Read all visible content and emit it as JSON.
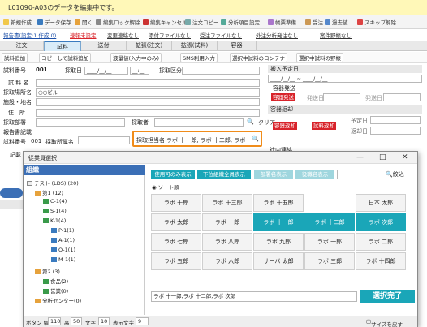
{
  "notice": "L01090-A03のデータを編集中です。",
  "toolbar": [
    "新規作成",
    "データ保存",
    "開く",
    "編集ロック解除",
    "編集キャンセル",
    "注文コピー",
    "分析項目設定",
    "帳票準備",
    "受注",
    "過去値",
    "スキップ解除"
  ],
  "links": [
    "報告書(設定:1 作成:0)",
    "速報未設定",
    "変更連絡なし",
    "添付ファイルなし",
    "受注ファイルなし",
    "外注分析発注なし",
    "案件野帳なし"
  ],
  "tabs": [
    "注文",
    "試料",
    "送付",
    "拡張(注文)",
    "拡張(試料)",
    "容器"
  ],
  "actions": [
    "試料追加",
    "コピーして試料追加",
    "液量値(入力中のみ)",
    "SMS利用入力",
    "選択中試料のコンテナ",
    "選択中試料の野帳"
  ],
  "form": {
    "no_label": "試料番号",
    "no_value": "001",
    "date_label": "採取日",
    "date_value": "____/__/__",
    "time_value": "__:__",
    "class_label": "採取区分",
    "name_label": "試 料 名",
    "place_label": "採取場所名",
    "place_value": "○○ビル",
    "facility_label": "施設・地名",
    "addr_label": "住　所",
    "dept_label": "採取部署",
    "staff_label": "採取者",
    "clear": "クリア",
    "report_label": "報告書記載",
    "sample_no_label": "試料番号",
    "sample_no_value": "001",
    "sample_place_label": "採取所属名",
    "person_label": "採取担当名",
    "person_value": "ラボ 十一郎, ラボ 十二郎, ラボ",
    "record_label": "記載"
  },
  "right": {
    "analysis_label": "搬入予定日",
    "analysis_value": "____/__/__ ~ ____/__/__",
    "container_label": "容器発送",
    "red1": "容器発送",
    "send_label": "発送日",
    "send_label2": "発送日",
    "return_label": "容器返却",
    "red2": "容器返却",
    "red3": "試料返却",
    "plan_label": "予定日",
    "ret_label": "返却日",
    "contact_label": "社内連絡"
  },
  "dialog": {
    "title": "従業員選択",
    "org": "組織",
    "filters": [
      "使用可のみ表示",
      "下位組織全員表示",
      "部署名表示",
      "役職名表示"
    ],
    "search_btn": "絞込",
    "sort": "ソート順",
    "tree": [
      {
        "label": "テスト (LDS) (20)",
        "level": 0
      },
      {
        "label": "第1 (12)",
        "level": 1
      },
      {
        "label": "C-1(4)",
        "level": 2
      },
      {
        "label": "S-1(4)",
        "level": 2
      },
      {
        "label": "K-1(4)",
        "level": 2
      },
      {
        "label": "P-1(1)",
        "level": 3
      },
      {
        "label": "A-1(1)",
        "level": 3
      },
      {
        "label": "O-1(1)",
        "level": 3
      },
      {
        "label": "M-1(1)",
        "level": 3
      },
      {
        "label": "第2 (3)",
        "level": 1
      },
      {
        "label": "食品(2)",
        "level": 2
      },
      {
        "label": "営業(0)",
        "level": 2
      },
      {
        "label": "分析センター(0)",
        "level": 1
      }
    ],
    "people": [
      [
        "ラボ 十郎",
        "ラボ 十三郎",
        "ラボ 十五郎",
        "日本 太郎"
      ],
      [
        "ラボ 太郎",
        "ラボ 一郎",
        "ラボ 十一郎",
        "ラボ 十二郎",
        "ラボ 次郎"
      ],
      [
        "ラボ 七郎",
        "ラボ 八郎",
        "ラボ 九郎",
        "ラボ 一郎",
        "ラボ 二郎"
      ],
      [
        "ラボ 五郎",
        "ラボ 六郎",
        "サーバ 太郎",
        "ラボ 三郎",
        "ラボ 十四郎"
      ]
    ],
    "selected_text": "ラボ 十一郎,ラボ 十二郎,ラボ 次郎",
    "done": "選択完了",
    "status_btn": "ボタン 幅",
    "status_btn_w": "110",
    "status_h": "高",
    "status_h_v": "50",
    "status_txt": "文字",
    "status_txt_v": "10",
    "status_disp": "表示文字",
    "status_disp_v": "9",
    "fit": "サイズを戻す"
  },
  "colors": {
    "accent": "#1aa6b8",
    "org_bar": "#3b6fb6",
    "red": "#d8232a",
    "highlight": "#f08c1a"
  }
}
